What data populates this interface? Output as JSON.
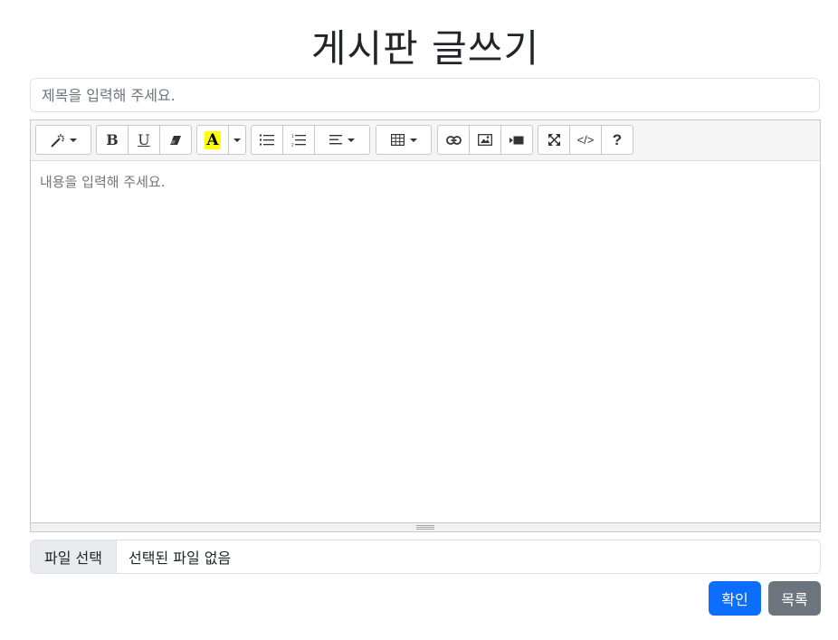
{
  "page": {
    "title": "게시판 글쓰기"
  },
  "form": {
    "title_placeholder": "제목을 입력해 주세요.",
    "title_value": ""
  },
  "editor": {
    "placeholder": "내용을 입력해 주세요.",
    "toolbar": {
      "style_icon": "magic-icon",
      "bold_label": "B",
      "underline_label": "U",
      "eraser_icon": "eraser-icon",
      "color_label": "A",
      "color_highlight": "#ffff00",
      "ul_icon": "unordered-list-icon",
      "ol_icon": "ordered-list-icon",
      "align_icon": "align-left-icon",
      "table_icon": "table-icon",
      "link_icon": "link-icon",
      "picture_icon": "picture-icon",
      "video_icon": "video-icon",
      "fullscreen_icon": "fullscreen-icon",
      "codeview_label": "</>",
      "help_label": "?"
    }
  },
  "file": {
    "button_label": "파일 선택",
    "status_text": "선택된 파일 없음"
  },
  "actions": {
    "confirm_label": "확인",
    "list_label": "목록"
  },
  "colors": {
    "primary": "#0d6efd",
    "secondary": "#6c757d"
  }
}
